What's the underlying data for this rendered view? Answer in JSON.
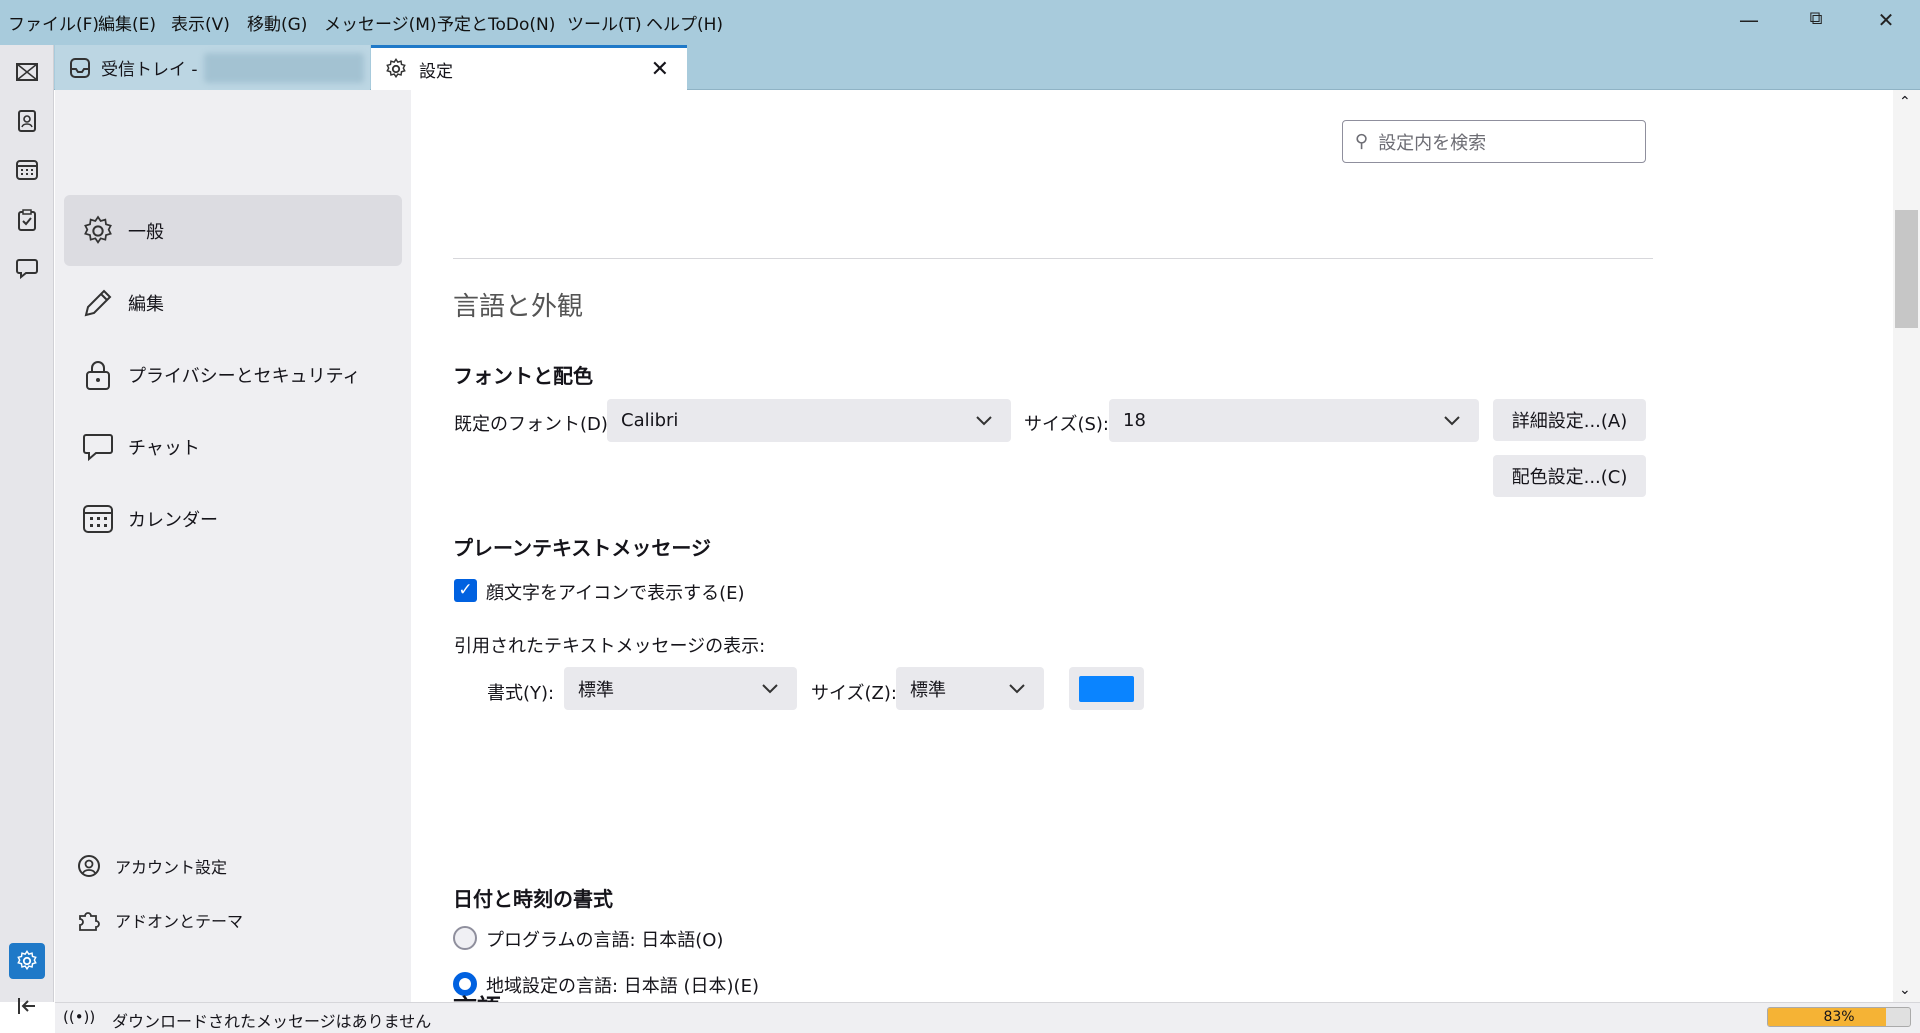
{
  "menubar": {
    "items": [
      "ファイル(F)",
      "編集(E)",
      "表示(V)",
      "移動(G)",
      "メッセージ(M)",
      "予定とToDo(N)",
      "ツール(T)",
      "ヘルプ(H)"
    ]
  },
  "tabs": [
    {
      "label": "受信トレイ -",
      "icon": "inbox-icon"
    },
    {
      "label": "設定",
      "icon": "gear-icon"
    }
  ],
  "sidebar": {
    "items": [
      {
        "label": "一般",
        "icon": "gear-icon"
      },
      {
        "label": "編集",
        "icon": "pencil-icon"
      },
      {
        "label": "プライバシーとセキュリティ",
        "icon": "lock-icon"
      },
      {
        "label": "チャット",
        "icon": "chat-icon"
      },
      {
        "label": "カレンダー",
        "icon": "calendar-icon"
      }
    ],
    "bottom": [
      {
        "label": "アカウント設定",
        "icon": "account-icon"
      },
      {
        "label": "アドオンとテーマ",
        "icon": "puzzle-icon"
      }
    ]
  },
  "search": {
    "placeholder": "設定内を検索"
  },
  "main": {
    "section_title": "言語と外観",
    "fonts": {
      "heading": "フォントと配色",
      "default_font_label": "既定のフォント(D):",
      "default_font_value": "Calibri",
      "size_label": "サイズ(S):",
      "size_value": "18",
      "advanced_button": "詳細設定...(A)",
      "colors_button": "配色設定...(C)"
    },
    "plaintext": {
      "heading": "プレーンテキストメッセージ",
      "emoticons_label": "顔文字をアイコンで表示する(E)",
      "emoticons_checked": true,
      "quoted_label": "引用されたテキストメッセージの表示:",
      "style_label": "書式(Y):",
      "style_value": "標準",
      "size_label": "サイズ(Z):",
      "size_value": "標準",
      "quote_color": "#0a84ff"
    },
    "datetime": {
      "heading": "日付と時刻の書式",
      "option_app": "プログラムの言語: 日本語(O)",
      "option_region": "地域設定の言語: 日本語 (日本)(E)",
      "selected": "region"
    },
    "next_heading": "言語"
  },
  "status": {
    "text": "ダウンロードされたメッセージはありません",
    "progress_percent": 83,
    "progress_label": "83%"
  },
  "colors": {
    "accent": "#0061e0",
    "progress": "#f5b335"
  }
}
